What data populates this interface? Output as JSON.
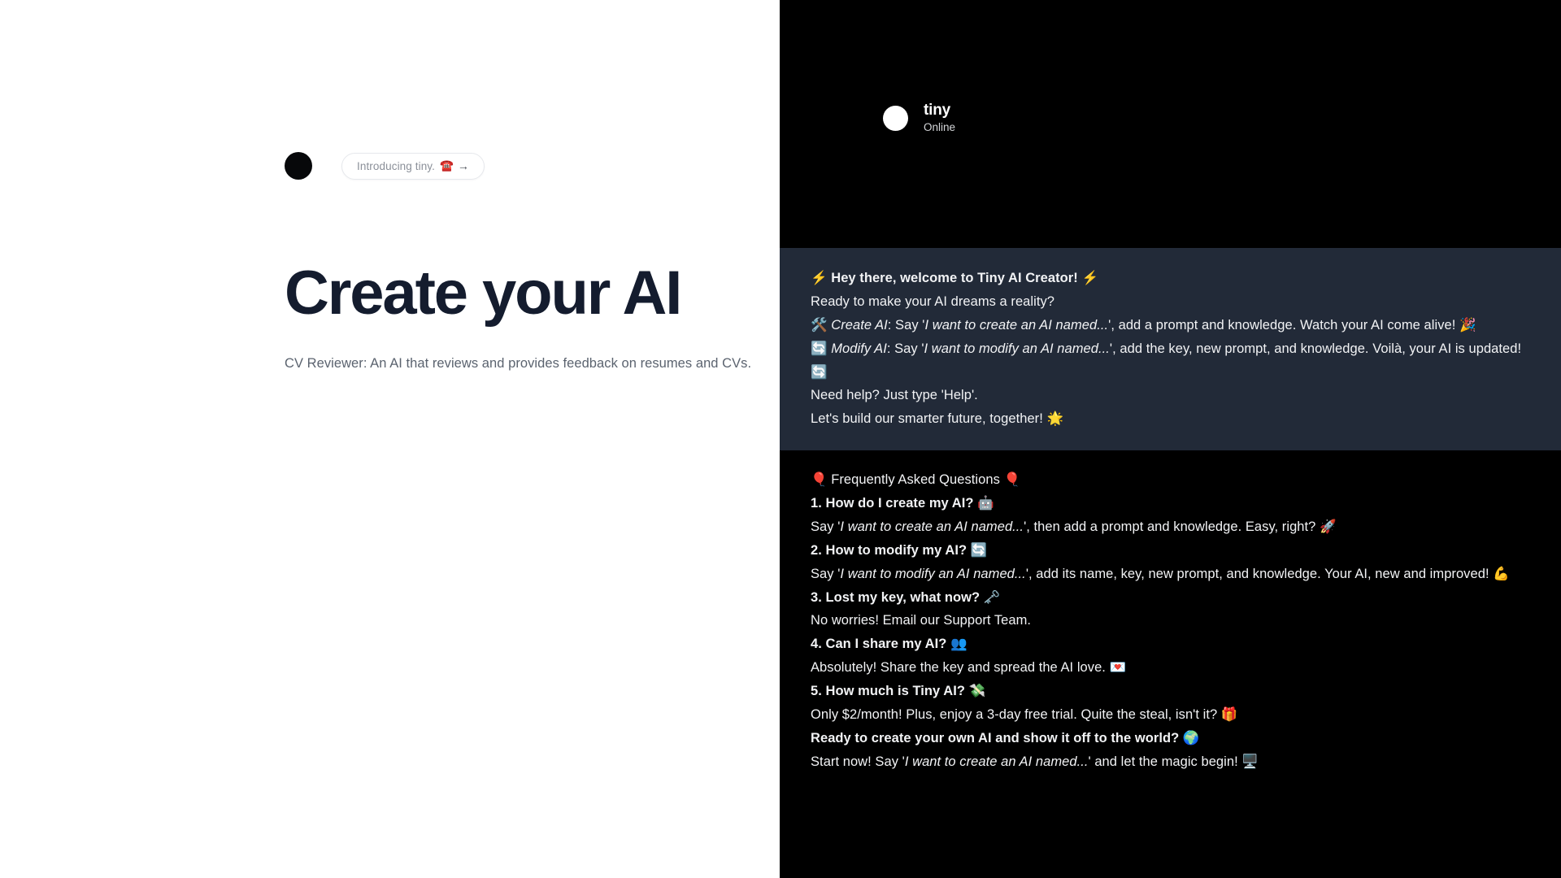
{
  "hero": {
    "logo_icon": "black-circle-logo",
    "badge": {
      "text": "Introducing tiny.",
      "emoji": "☎️",
      "arrow": "→"
    },
    "title": "Create your AI",
    "subtitle": "CV Reviewer: An AI that reviews and provides feedback on resumes and CVs."
  },
  "chat": {
    "avatar_icon": "white-circle-avatar",
    "name": "tiny",
    "status": "Online",
    "messages": [
      {
        "id": "welcome",
        "background": "#222a38",
        "lines": [
          "⚡ <b>Hey there, welcome to Tiny AI Creator!</b> ⚡",
          "Ready to make your AI dreams a reality?",
          "🛠️ <i>Create AI</i>: Say '<i>I want to create an AI named...</i>', add a prompt and knowledge. Watch your AI come alive! 🎉",
          "🔄 <i>Modify AI</i>: Say '<i>I want to modify an AI named...</i>', add the key, new prompt, and knowledge. Voilà, your AI is updated! 🔄",
          "Need help? Just type 'Help'.",
          "Let's build our smarter future, together! 🌟"
        ]
      },
      {
        "id": "faq",
        "background": "#000000",
        "lines": [
          "🎈 Frequently Asked Questions 🎈",
          "<b>1. How do I create my AI?</b> 🤖",
          "Say '<i>I want to create an AI named...</i>', then add a prompt and knowledge. Easy, right? 🚀",
          "<b>2. How to modify my AI?</b> 🔄",
          "Say '<i>I want to modify an AI named...</i>', add its name, key, new prompt, and knowledge. Your AI, new and improved! 💪",
          "<b>3. Lost my key, what now?</b> 🗝️",
          "No worries! Email our Support Team.",
          "<b>4. Can I share my AI?</b> 👥",
          "Absolutely! Share the key and spread the AI love. 💌",
          "<b>5. How much is Tiny AI?</b> 💸",
          "Only $2/month! Plus, enjoy a 3-day free trial. Quite the steal, isn't it? 🎁",
          "<b>Ready to create your own AI and show it off to the world?</b> 🌍",
          "Start now! Say '<i>I want to create an AI named...</i>' and let the magic begin! 🖥️"
        ]
      }
    ]
  },
  "colors": {
    "page_background": "#ffffff",
    "chat_background": "#000000",
    "welcome_bubble": "#222a38",
    "title_color": "#141c2e",
    "subtitle_color": "#5b636f",
    "badge_text_color": "#8b9099"
  }
}
